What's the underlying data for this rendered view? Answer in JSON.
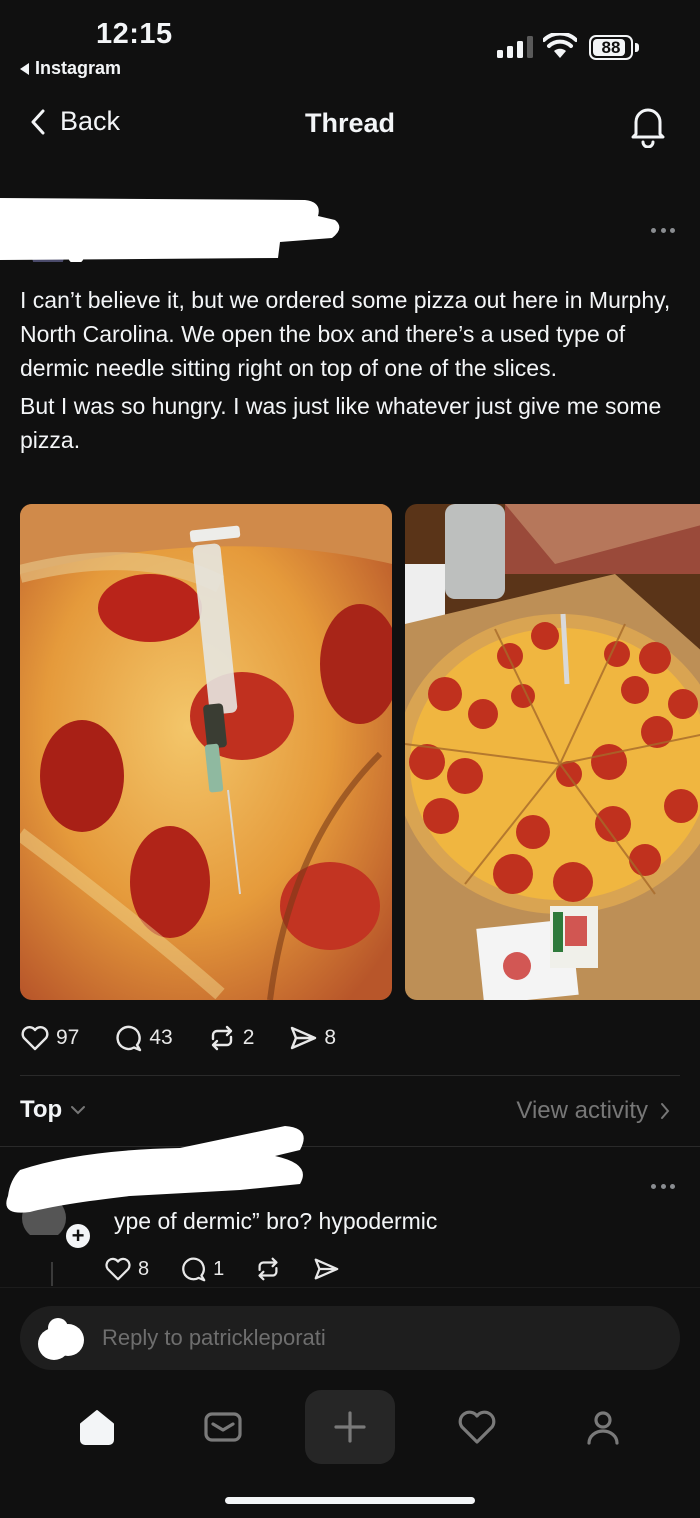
{
  "status_bar": {
    "time": "12:15",
    "back_app": "Instagram",
    "battery": "88",
    "battery_level": 0.88
  },
  "nav": {
    "back_label": "Back",
    "title": "Thread"
  },
  "post": {
    "paragraphs": [
      "I can’t believe it, but we ordered some pizza out here in Murphy, North Carolina. We open the box and there’s a used type of dermic needle sitting right on top of one of the slices.",
      "But I was so hungry. I was just like whatever just give me some pizza."
    ],
    "stats": {
      "likes": "97",
      "replies": "43",
      "reposts": "2",
      "shares": "8"
    }
  },
  "replies_header": {
    "sort_label": "Top",
    "view_activity": "View activity"
  },
  "comment": {
    "text": "ype of dermic” bro? hypodermic",
    "stats": {
      "likes": "8",
      "replies": "1"
    }
  },
  "composer": {
    "placeholder": "Reply to patrickleporati"
  },
  "icons": {
    "nav_back": "chevron-left-icon",
    "notifications": "bell-icon",
    "like": "heart-icon",
    "reply": "speech-bubble-icon",
    "repost": "repost-icon",
    "share": "send-icon",
    "tabs": [
      "home-icon",
      "inbox-icon",
      "plus-icon",
      "heart-icon",
      "profile-icon"
    ]
  },
  "colors": {
    "background": "#101010",
    "text": "#f3f5f7",
    "muted": "#777777",
    "composer": "#1e1e1e"
  }
}
